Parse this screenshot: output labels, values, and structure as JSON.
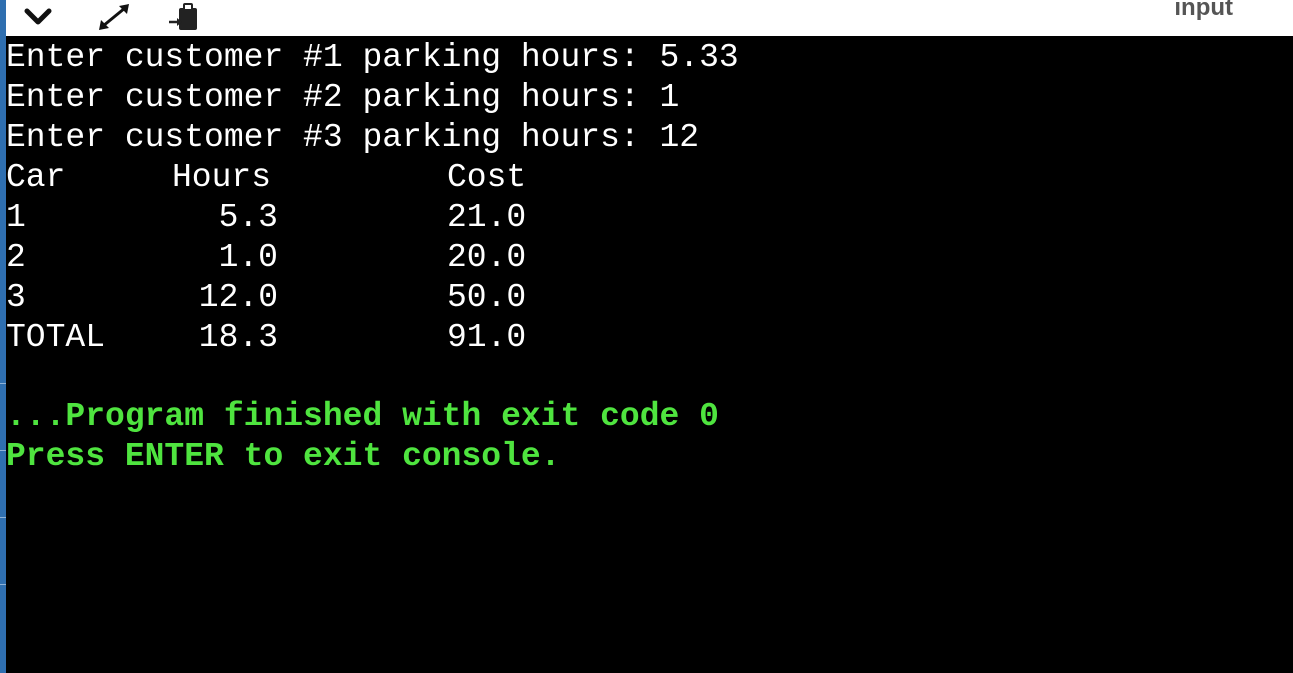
{
  "toolbar": {
    "input_label": "input",
    "icons": [
      "chevron-down-icon",
      "expand-icon",
      "clipboard-paste-icon"
    ]
  },
  "console": {
    "prompts": [
      "Enter customer #1 parking hours: 5.33",
      "Enter customer #2 parking hours: 1",
      "Enter customer #3 parking hours: 12"
    ],
    "table": {
      "headers": [
        "Car",
        "Hours",
        "Cost"
      ],
      "rows": [
        [
          "1",
          "5.3",
          "21.0"
        ],
        [
          "2",
          "1.0",
          "20.0"
        ],
        [
          "3",
          "12.0",
          "50.0"
        ],
        [
          "TOTAL",
          "18.3",
          "91.0"
        ]
      ]
    },
    "exit_message": "...Program finished with exit code 0",
    "press_enter": "Press ENTER to exit console."
  },
  "colors": {
    "console_bg": "#000000",
    "console_text": "#ffffff",
    "status_text": "#4fe43f",
    "toolbar_bg": "#ffffff",
    "left_strip": "#2f6fb0"
  }
}
